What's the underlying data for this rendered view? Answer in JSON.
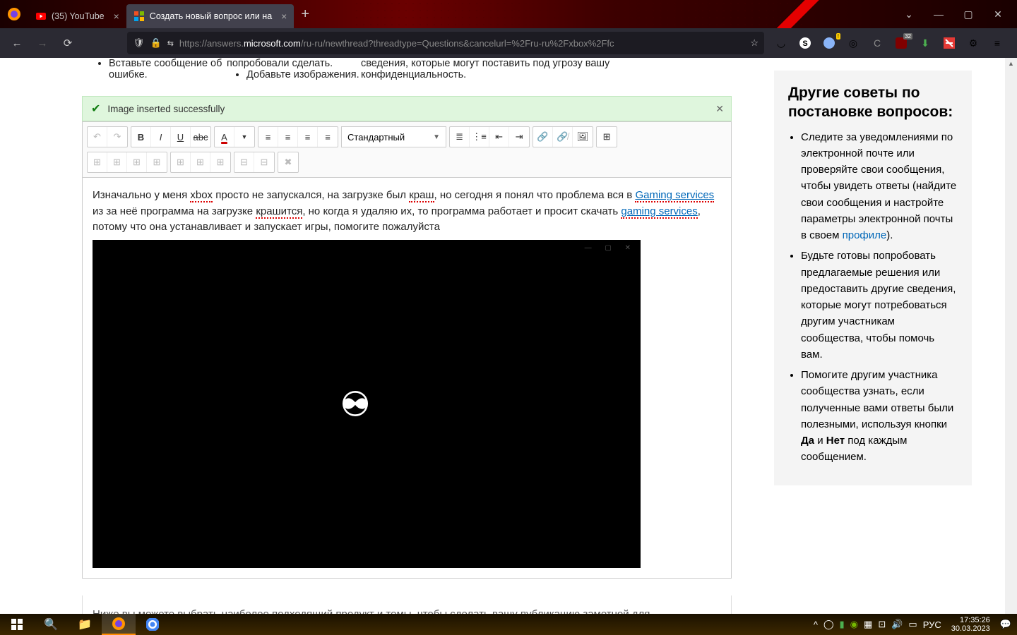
{
  "browser": {
    "tabs": [
      {
        "title": "(35) YouTube",
        "favicon": "youtube"
      },
      {
        "title": "Создать новый вопрос или на",
        "favicon": "microsoft",
        "active": true
      }
    ],
    "url_prefix": "https://answers.",
    "url_domain": "microsoft.com",
    "url_path": "/ru-ru/newthread?threadtype=Questions&cancelurl=%2Fru-ru%2Fxbox%2Ffc",
    "ext_badge_1": "!",
    "ext_badge_2": "32"
  },
  "tips_top": {
    "c1_items": [
      "Вставьте сообщение об ошибке."
    ],
    "c2_items": [
      "попробовали сделать.",
      "Добавьте изображения."
    ],
    "c3_items": [
      "сведения, которые могут поставить под угрозу вашу конфиденциальность."
    ]
  },
  "alert": {
    "text": "Image inserted successfully"
  },
  "editor": {
    "style_select": "Стандартный",
    "body_text_1a": "Изначально у меня ",
    "body_word_xbox": "xbox",
    "body_text_1b": " просто не запускался, на загрузке был ",
    "body_word_crash": "краш",
    "body_text_1c": ", но сегодня я понял что проблема вся в ",
    "body_link_gs1": "Gaming services",
    "body_text_2a": " из за неё программа на загрузке ",
    "body_word_crash2": "крашится",
    "body_text_2b": ", но когда я удаляю их, то программа работает и просит скачать ",
    "body_link_gs2": "gaming services",
    "body_text_3": ", потому что она устанавливает и запускает игры, помогите пожалуйста"
  },
  "footer_hint": "Ниже вы можете выбрать наиболее подходящий продукт и темы, чтобы сделать вашу публикацию заметной для",
  "sidebar": {
    "heading": "Другие советы по постановке вопросов:",
    "tip1_a": "Следите за уведомлениями по электронной почте или проверяйте свои сообщения, чтобы увидеть ответы (найдите свои сообщения и настройте параметры электронной почты в своем ",
    "tip1_link": "профиле",
    "tip1_b": ").",
    "tip2": "Будьте готовы попробовать предлагаемые решения или предоставить другие сведения, которые могут потребоваться другим участникам сообщества, чтобы помочь вам.",
    "tip3_a": "Помогите другим участника сообщества узнать, если полученные вами ответы были полезными, используя кнопки ",
    "tip3_yes": "Да",
    "tip3_and": " и ",
    "tip3_no": "Нет",
    "tip3_b": " под каждым сообщением."
  },
  "taskbar": {
    "lang": "РУС",
    "time": "17:35:26",
    "date": "30.03.2023"
  }
}
